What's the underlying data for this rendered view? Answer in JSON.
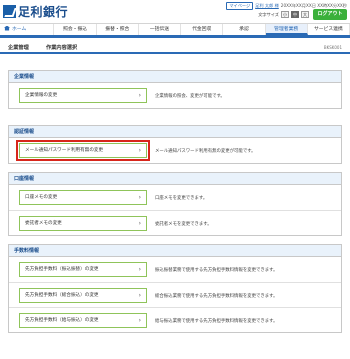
{
  "header": {
    "bank_name": "足利銀行",
    "mypage_label": "マイページ",
    "user_name": "足利 太郎 様",
    "last_login": "20XX年XX月XX日 XX時XX分XX秒",
    "font_size_label": "文字サイズ",
    "font_sizes": [
      "小",
      "中",
      "大"
    ],
    "logout_label": "ログアウト"
  },
  "nav": {
    "items": [
      {
        "label": "ホーム"
      },
      {
        "label": "照会・振込"
      },
      {
        "label": "振替・照合"
      },
      {
        "label": "一括伝送"
      },
      {
        "label": "代金回収"
      },
      {
        "label": "承認"
      },
      {
        "label": "管理者業務"
      },
      {
        "label": "サービス連携"
      }
    ],
    "active_index": 6
  },
  "page": {
    "category": "企業管理",
    "title": "作業内容選択",
    "screen_id": "BKSK001"
  },
  "sections": [
    {
      "heading": "企業情報",
      "rows": [
        {
          "button": "企業情報の変更",
          "desc": "企業情報の照会、変更が可能です。"
        }
      ]
    },
    {
      "heading": "認証情報",
      "rows": [
        {
          "button": "メール通知パスワード利用有無の変更",
          "desc": "メール通知パスワード利用有無の変更が可能です。"
        }
      ]
    },
    {
      "heading": "口座情報",
      "rows": [
        {
          "button": "口座メモの変更",
          "desc": "口座メモを変更できます。"
        },
        {
          "button": "委託者メモの変更",
          "desc": "委託者メモを変更できます。"
        }
      ]
    },
    {
      "heading": "手数料情報",
      "rows": [
        {
          "button": "先方負担手数料（振込振替）の変更",
          "desc": "振込振替業務で使用する先方負担手数料情報を変更できます。"
        },
        {
          "button": "先方負担手数料（総合振込）の変更",
          "desc": "総合振込業務で使用する先方負担手数料情報を変更できます。"
        },
        {
          "button": "先方負担手数料（給与振込）の変更",
          "desc": "給与振込業務で使用する先方負担手数料情報を変更できます。"
        }
      ]
    }
  ],
  "colors": {
    "brand_blue": "#2a6ab5",
    "button_border_green": "#8fc45a",
    "highlight_red": "#d8261b",
    "logout_green": "#3bb03b"
  }
}
